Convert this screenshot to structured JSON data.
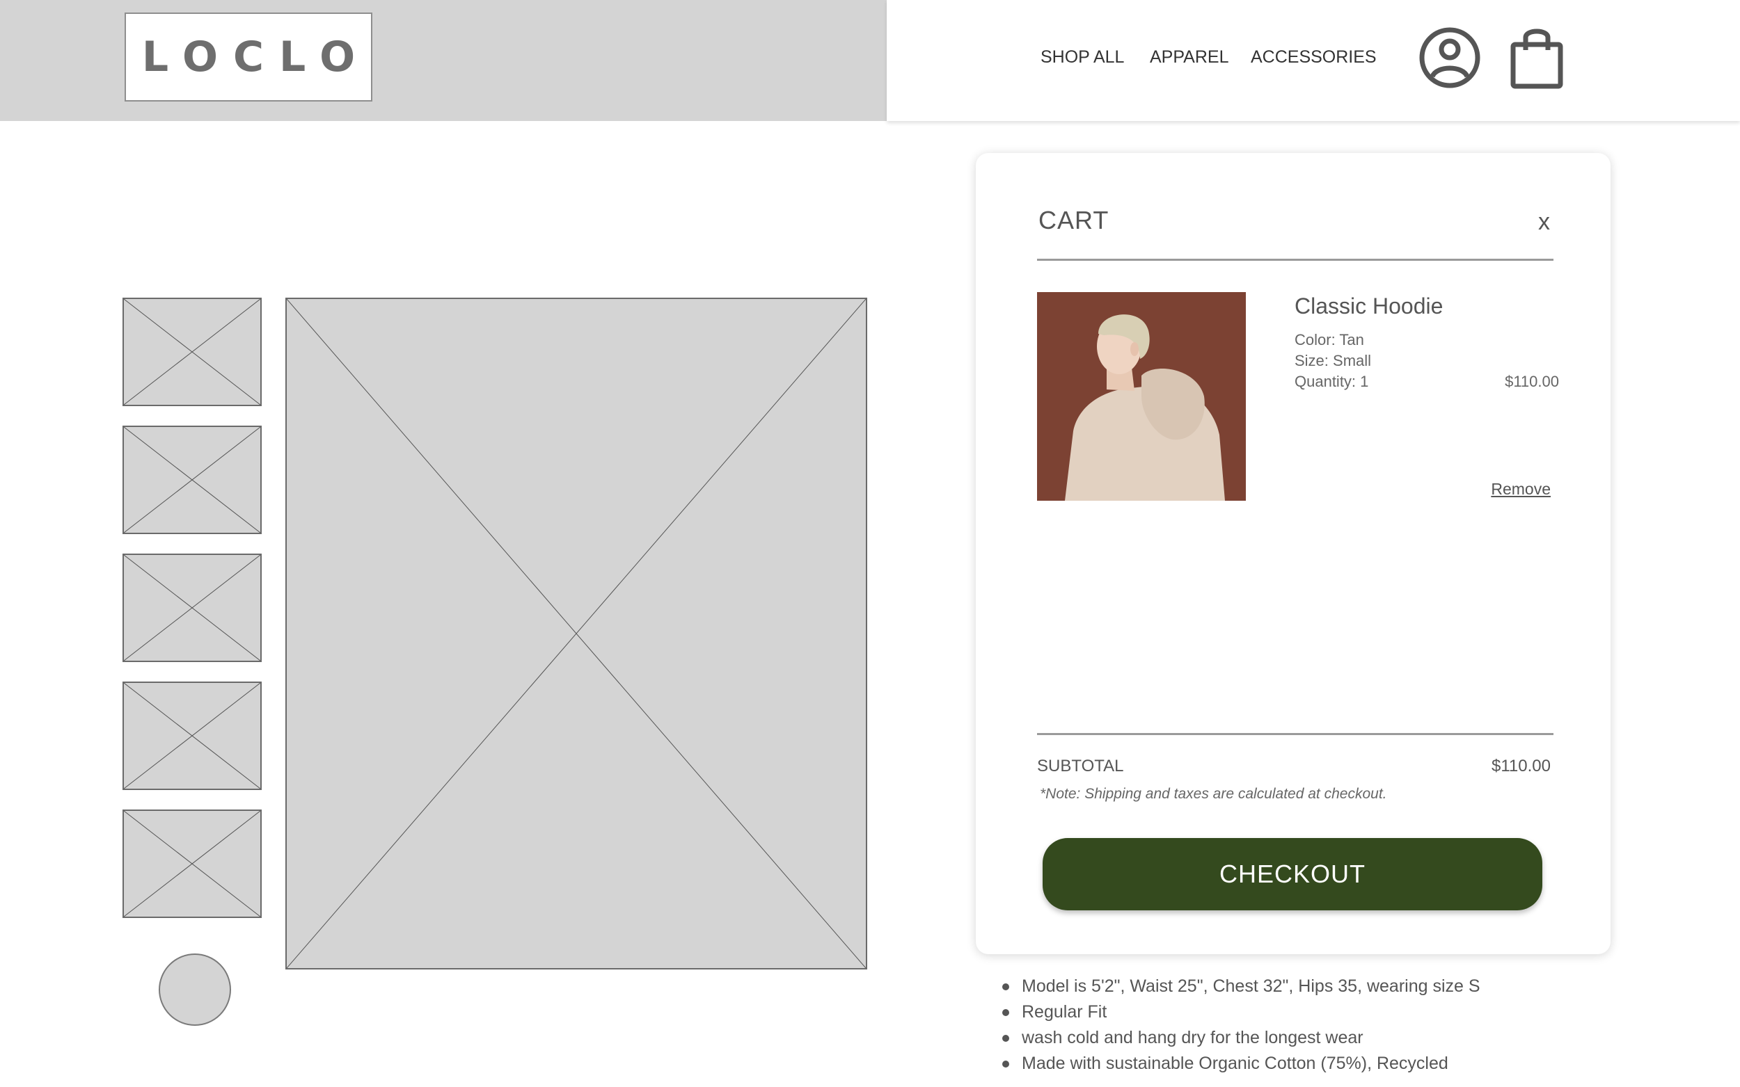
{
  "brand": {
    "logo": "LOCLO"
  },
  "nav": {
    "links": [
      {
        "label": "SHOP ALL"
      },
      {
        "label": "APPAREL"
      },
      {
        "label": "ACCESSORIES"
      }
    ],
    "account_icon": "user-circle-icon",
    "cart_icon": "shopping-bag-icon"
  },
  "gallery": {
    "thumbnail_count": 5,
    "placeholder_style": "wireframe-x"
  },
  "cart": {
    "title": "CART",
    "close_label": "x",
    "item": {
      "name": "Classic Hoodie",
      "color": "Color: Tan",
      "size": "Size: Small",
      "quantity": "Quantity: 1",
      "price": "$110.00",
      "remove_label": "Remove"
    },
    "subtotal_label": "SUBTOTAL",
    "subtotal_value": "$110.00",
    "note": "*Note: Shipping and taxes are calculated at checkout.",
    "checkout_label": "CHECKOUT"
  },
  "details": [
    "Model is 5'2\", Waist 25\", Chest 32\", Hips 35, wearing size S",
    "Regular Fit",
    "wash cold and hang dry for the longest wear",
    "Made with sustainable Organic Cotton (75%), Recycled"
  ],
  "colors": {
    "header_gray": "#d4d4d4",
    "checkout_green": "#344a1e",
    "photo_background": "#7c4233"
  }
}
